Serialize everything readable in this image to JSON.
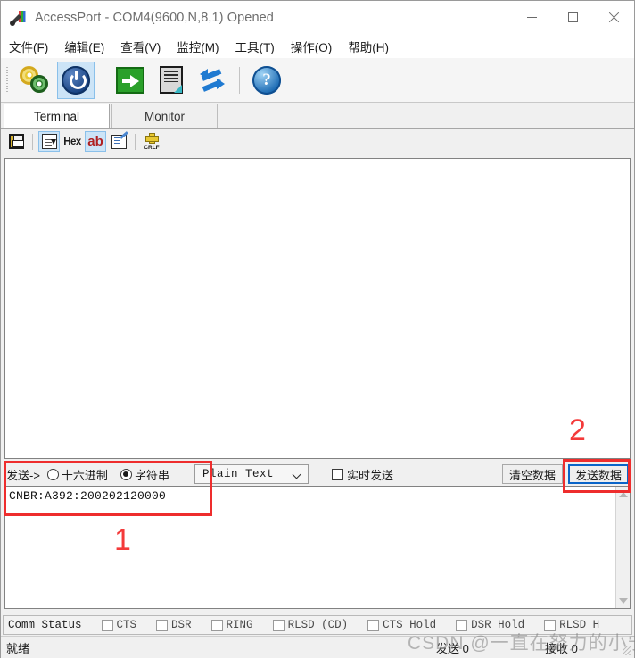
{
  "window": {
    "title": "AccessPort - COM4(9600,N,8,1) Opened",
    "icon": "serial-plug-icon",
    "controls": {
      "minimize": "minimize-icon",
      "maximize": "maximize-icon",
      "close": "close-icon"
    }
  },
  "menubar": {
    "items": [
      {
        "label": "文件(F)"
      },
      {
        "label": "编辑(E)"
      },
      {
        "label": "查看(V)"
      },
      {
        "label": "监控(M)"
      },
      {
        "label": "工具(T)"
      },
      {
        "label": "操作(O)"
      },
      {
        "label": "帮助(H)"
      }
    ]
  },
  "toolbar": {
    "buttons": [
      {
        "name": "config-gears-icon",
        "active": false
      },
      {
        "name": "power-toggle-icon",
        "active": true
      },
      {
        "name": "green-arrow-send-icon",
        "active": false
      },
      {
        "name": "document-icon",
        "active": false
      },
      {
        "name": "refresh-arrows-icon",
        "active": false
      },
      {
        "name": "help-question-icon",
        "active": false
      }
    ]
  },
  "tabs": [
    {
      "label": "Terminal",
      "selected": true
    },
    {
      "label": "Monitor",
      "selected": false
    }
  ],
  "subtoolbar": {
    "buttons": [
      {
        "name": "save-icon",
        "label": "",
        "active": false
      },
      {
        "name": "autoscroll-icon",
        "label": "",
        "active": true
      },
      {
        "name": "hex-toggle",
        "label": "Hex",
        "active": false
      },
      {
        "name": "ascii-toggle",
        "label": "ab",
        "active": true
      },
      {
        "name": "edit-checklist-icon",
        "label": "",
        "active": false
      },
      {
        "name": "crlf-icon",
        "label": "CRLF",
        "active": false
      }
    ]
  },
  "terminal": {
    "content": ""
  },
  "sendbar": {
    "label": "发送->",
    "radios": [
      {
        "label": "十六进制",
        "selected": false
      },
      {
        "label": "字符串",
        "selected": true
      }
    ],
    "format_select": {
      "value": "Plain Text"
    },
    "realtime_checkbox": {
      "label": "实时发送",
      "checked": false
    },
    "clear_button": "清空数据",
    "send_button": "发送数据"
  },
  "send_input": {
    "value": "CNBR:A392:200202120000",
    "placeholder": ""
  },
  "comm_status": {
    "title": "Comm Status",
    "signals": [
      {
        "label": "CTS",
        "checked": false
      },
      {
        "label": "DSR",
        "checked": false
      },
      {
        "label": "RING",
        "checked": false
      },
      {
        "label": "RLSD (CD)",
        "checked": false
      },
      {
        "label": "CTS Hold",
        "checked": false
      },
      {
        "label": "DSR Hold",
        "checked": false
      },
      {
        "label": "RLSD H",
        "checked": false
      }
    ]
  },
  "statusbar": {
    "ready": "就绪",
    "sent": "发送 0",
    "received": "接收 0"
  },
  "watermark": {
    "text": "CSDN @一直在努力的小宁"
  },
  "annotations": [
    {
      "number": "1",
      "target": "send-input-area"
    },
    {
      "number": "2",
      "target": "send-data-button"
    }
  ],
  "colors": {
    "annotation_red": "#ee2d2d",
    "annotation_number_red": "#f43a3a",
    "active_toolbar_blue": "#cce4f7",
    "focus_border_blue": "#0a64c8",
    "ab_toggle_red": "#b02020"
  }
}
